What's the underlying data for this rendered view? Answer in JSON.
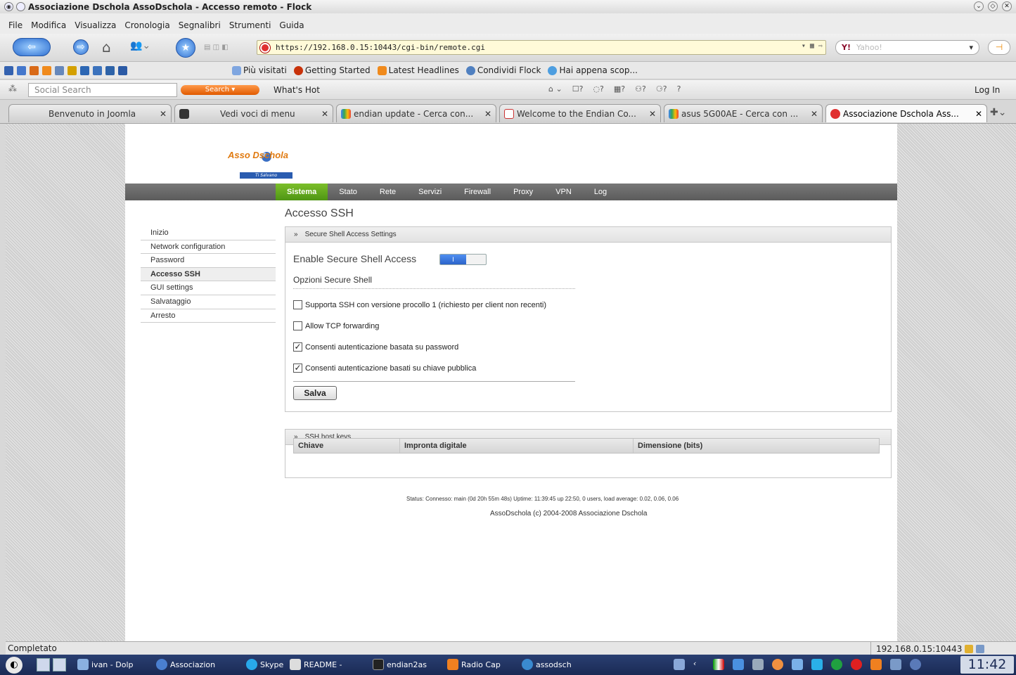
{
  "window": {
    "title": "Associazione Dschola AssoDschola - Accesso remoto - Flock"
  },
  "menubar": [
    "File",
    "Modifica",
    "Visualizza",
    "Cronologia",
    "Segnalibri",
    "Strumenti",
    "Guida"
  ],
  "navbar": {
    "url": "https://192.168.0.15:10443/cgi-bin/remote.cgi",
    "search_engine": "Y!",
    "search_placeholder": "Yahoo!"
  },
  "bookmarks": [
    {
      "label": "Più visitati",
      "icon": "folder-icon"
    },
    {
      "label": "Getting Started",
      "icon": "flock-icon"
    },
    {
      "label": "Latest Headlines",
      "icon": "rss-icon"
    },
    {
      "label": "Condividi Flock",
      "icon": "share-icon"
    },
    {
      "label": "Hai appena scop...",
      "icon": "people-icon"
    }
  ],
  "socialbar": {
    "search_placeholder": "Social Search",
    "search_button": "Search",
    "whats_hot": "What's Hot",
    "counters": [
      "?",
      "?",
      "?",
      "?",
      "?",
      "?"
    ],
    "login": "Log In"
  },
  "tabs": [
    {
      "label": "Benvenuto in Joomla",
      "active": false
    },
    {
      "label": "Vedi voci di menu",
      "active": false
    },
    {
      "label": "endian update - Cerca con...",
      "active": false
    },
    {
      "label": "Welcome to the Endian Co...",
      "active": false
    },
    {
      "label": "asus 5G00AE - Cerca con ...",
      "active": false
    },
    {
      "label": "Associazione Dschola Ass...",
      "active": true
    }
  ],
  "site": {
    "logo_text": "Asso Dschola",
    "logo_tagline": "Ti Salvano",
    "mainnav": [
      "Sistema",
      "Stato",
      "Rete",
      "Servizi",
      "Firewall",
      "Proxy",
      "VPN",
      "Log"
    ],
    "mainnav_active": "Sistema",
    "page_title": "Accesso SSH",
    "sidenav": [
      "Inizio",
      "Network configuration",
      "Password",
      "Accesso SSH",
      "GUI settings",
      "Salvataggio",
      "Arresto"
    ],
    "sidenav_active": "Accesso SSH"
  },
  "ssh_panel": {
    "header_arrow": "»",
    "header": "Secure Shell Access Settings",
    "enable_label": "Enable Secure Shell Access",
    "toggle_on_text": "I",
    "toggle_enabled": true,
    "options_title": "Opzioni Secure Shell",
    "options": [
      {
        "label": "Supporta SSH con versione procollo 1 (richiesto per client non recenti)",
        "checked": false
      },
      {
        "label": "Allow TCP forwarding",
        "checked": false
      },
      {
        "label": "Consenti autenticazione basata su password",
        "checked": true
      },
      {
        "label": "Consenti autenticazione basati su chiave pubblica",
        "checked": true
      }
    ],
    "save_button": "Salva"
  },
  "keys_panel": {
    "header_arrow": "»",
    "header": "SSH host keys",
    "columns": [
      "Chiave",
      "Impronta digitale",
      "Dimensione (bits)"
    ]
  },
  "footer": {
    "status": "Status: Connesso: main (0d 20h 55m 48s) Uptime: 11:39:45 up 22:50, 0 users, load average: 0.02, 0.06, 0.06",
    "copyright": "AssoDschola (c) 2004-2008 Associazione Dschola"
  },
  "statusbar": {
    "text": "Completato",
    "host": "192.168.0.15:10443"
  },
  "taskbar": {
    "tasks": [
      {
        "label": "ivan - Dolp",
        "icon": "folder-icon"
      },
      {
        "label": "Associazion",
        "icon": "browser-icon"
      },
      {
        "label": "Skype",
        "icon": "skype-icon"
      },
      {
        "label": "README -",
        "icon": "editor-icon"
      },
      {
        "label": "endian2as",
        "icon": "terminal-icon"
      },
      {
        "label": "Radio Cap",
        "icon": "vlc-icon"
      },
      {
        "label": "assodsch",
        "icon": "chat-icon"
      }
    ],
    "clock": "11:42"
  },
  "colors": {
    "accent_green": "#5aa31c",
    "nav_gray": "#666666",
    "toggle_blue": "#3a77df"
  }
}
